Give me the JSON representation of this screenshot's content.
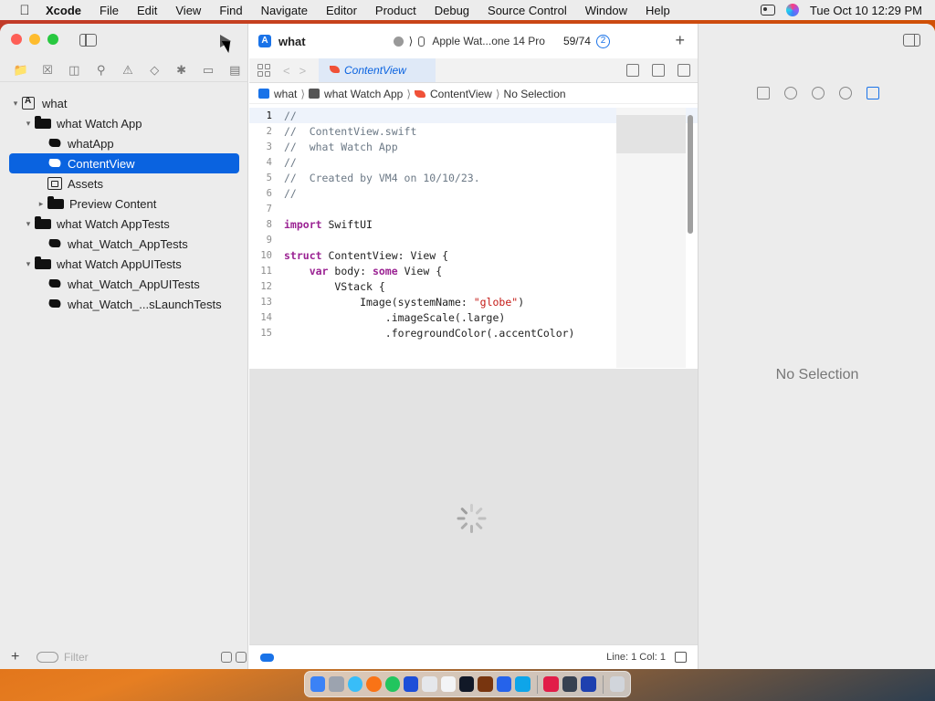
{
  "menubar": {
    "app_name": "Xcode",
    "items": [
      "File",
      "Edit",
      "View",
      "Find",
      "Navigate",
      "Editor",
      "Product",
      "Debug",
      "Source Control",
      "Window",
      "Help"
    ],
    "clock": "Tue Oct 10  12:29 PM"
  },
  "toolbar": {
    "project_title": "what",
    "scheme_device": "Apple Wat...one 14 Pro",
    "progress": "59/74",
    "badge_count": "2"
  },
  "editor_tab": {
    "label": "ContentView"
  },
  "breadcrumb": {
    "items": [
      "what",
      "what Watch App",
      "ContentView",
      "No Selection"
    ]
  },
  "navigator": {
    "tree": [
      {
        "label": "what",
        "indent": 0,
        "icon": "project-icon",
        "expanded": true
      },
      {
        "label": "what Watch App",
        "indent": 1,
        "icon": "folder-icon",
        "expanded": true
      },
      {
        "label": "whatApp",
        "indent": 2,
        "icon": "swift-file-icon"
      },
      {
        "label": "ContentView",
        "indent": 2,
        "icon": "swift-file-icon",
        "selected": true
      },
      {
        "label": "Assets",
        "indent": 2,
        "icon": "assets-icon"
      },
      {
        "label": "Preview Content",
        "indent": 2,
        "icon": "folder-icon",
        "expanded": false
      },
      {
        "label": "what Watch AppTests",
        "indent": 1,
        "icon": "folder-icon",
        "expanded": true
      },
      {
        "label": "what_Watch_AppTests",
        "indent": 2,
        "icon": "swift-file-icon"
      },
      {
        "label": "what Watch AppUITests",
        "indent": 1,
        "icon": "folder-icon",
        "expanded": true
      },
      {
        "label": "what_Watch_AppUITests",
        "indent": 2,
        "icon": "swift-file-icon"
      },
      {
        "label": "what_Watch_...sLaunchTests",
        "indent": 2,
        "icon": "swift-file-icon"
      }
    ],
    "filter_placeholder": "Filter"
  },
  "code": {
    "lines": [
      [
        [
          "cm",
          "//"
        ]
      ],
      [
        [
          "cm",
          "//  ContentView.swift"
        ]
      ],
      [
        [
          "cm",
          "//  what Watch App"
        ]
      ],
      [
        [
          "cm",
          "//"
        ]
      ],
      [
        [
          "cm",
          "//  Created by VM4 on 10/10/23."
        ]
      ],
      [
        [
          "cm",
          "//"
        ]
      ],
      [],
      [
        [
          "kw",
          "import"
        ],
        [
          "",
          " SwiftUI"
        ]
      ],
      [],
      [
        [
          "kw",
          "struct"
        ],
        [
          "",
          " ContentView: View {"
        ]
      ],
      [
        [
          "",
          "    "
        ],
        [
          "kw",
          "var"
        ],
        [
          "",
          " body: "
        ],
        [
          "kw",
          "some"
        ],
        [
          "",
          " View {"
        ]
      ],
      [
        [
          "",
          "        VStack {"
        ]
      ],
      [
        [
          "",
          "            Image(systemName: "
        ],
        [
          "st",
          "\"globe\""
        ],
        [
          "",
          ")"
        ]
      ],
      [
        [
          "",
          "                .imageScale(.large)"
        ]
      ],
      [
        [
          "",
          "                .foregroundColor(.accentColor)"
        ]
      ]
    ]
  },
  "status": {
    "line_col": "Line: 1  Col: 1"
  },
  "inspector": {
    "no_selection": "No Selection"
  },
  "colors": {
    "accent": "#0a63e0",
    "swift": "#f05138",
    "keyword": "#9b2393",
    "string": "#c41a16",
    "comment": "#6c7986"
  }
}
